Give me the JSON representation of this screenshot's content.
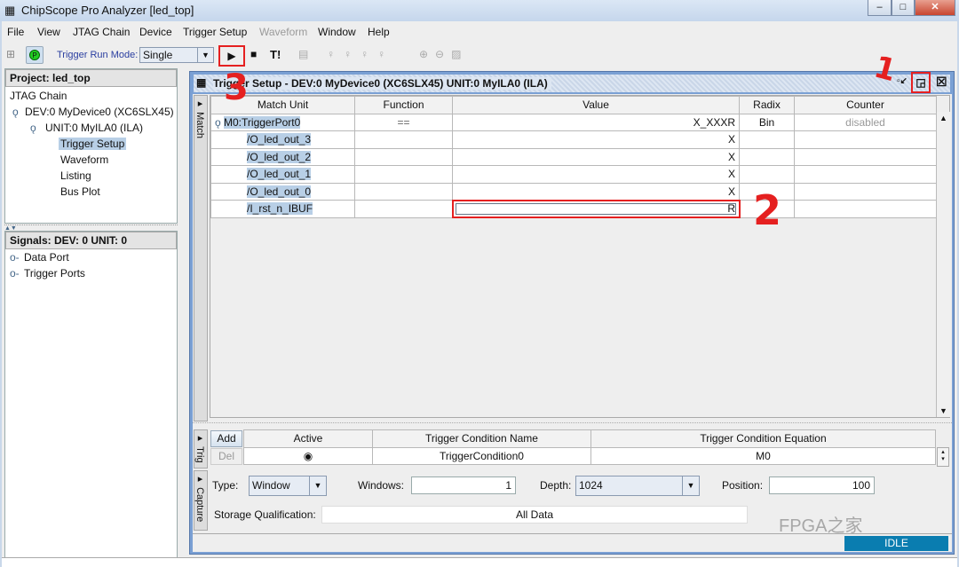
{
  "window": {
    "title": "ChipScope Pro Analyzer [led_top]",
    "controls": [
      "minimize",
      "maximize",
      "close"
    ]
  },
  "menu": [
    {
      "label": "File"
    },
    {
      "label": "View"
    },
    {
      "label": "JTAG Chain"
    },
    {
      "label": "Device"
    },
    {
      "label": "Trigger Setup"
    },
    {
      "label": "Waveform",
      "disabled": true
    },
    {
      "label": "Window"
    },
    {
      "label": "Help"
    }
  ],
  "toolbar": {
    "run_mode_label": "Trigger Run Mode:",
    "run_mode_value": "Single",
    "trigger_immediate": "T!",
    "status_led": "P"
  },
  "project": {
    "header": "Project: led_top",
    "tree": [
      "JTAG Chain",
      "DEV:0 MyDevice0 (XC6SLX45)",
      "UNIT:0 MyILA0 (ILA)",
      "Trigger Setup",
      "Waveform",
      "Listing",
      "Bus Plot"
    ],
    "selected": "Trigger Setup"
  },
  "signals": {
    "header": "Signals: DEV: 0 UNIT: 0",
    "items": [
      "Data Port",
      "Trigger Ports"
    ]
  },
  "trigger_window": {
    "title": "Trigger Setup - DEV:0 MyDevice0 (XC6SLX45) UNIT:0 MyILA0 (ILA)",
    "match_tab": "Match",
    "trig_tab": "Trig",
    "capture_tab": "Capture",
    "columns": [
      "Match Unit",
      "Function",
      "Value",
      "Radix",
      "Counter"
    ],
    "rows": [
      {
        "unit": "M0:TriggerPort0",
        "function": "==",
        "value": "X_XXXR",
        "radix": "Bin",
        "counter": "disabled"
      },
      {
        "unit": "/O_led_out_3",
        "function": "",
        "value": "X",
        "radix": "",
        "counter": ""
      },
      {
        "unit": "/O_led_out_2",
        "function": "",
        "value": "X",
        "radix": "",
        "counter": ""
      },
      {
        "unit": "/O_led_out_1",
        "function": "",
        "value": "X",
        "radix": "",
        "counter": ""
      },
      {
        "unit": "/O_led_out_0",
        "function": "",
        "value": "X",
        "radix": "",
        "counter": ""
      },
      {
        "unit": "/I_rst_n_IBUF",
        "function": "",
        "value": "R",
        "radix": "",
        "counter": ""
      }
    ],
    "trig": {
      "add": "Add",
      "del": "Del",
      "columns": [
        "Active",
        "Trigger Condition Name",
        "Trigger Condition Equation"
      ],
      "row": {
        "active": true,
        "name": "TriggerCondition0",
        "equation": "M0"
      }
    },
    "capture": {
      "type_label": "Type:",
      "type_value": "Window",
      "windows_label": "Windows:",
      "windows_value": "1",
      "depth_label": "Depth:",
      "depth_value": "1024",
      "position_label": "Position:",
      "position_value": "100",
      "storage_label": "Storage Qualification:",
      "storage_value": "All Data"
    },
    "status": "IDLE"
  },
  "annotations": [
    "1",
    "2",
    "3"
  ],
  "watermark": "FPGA之家",
  "colors": {
    "status_bar": "#0a7db0",
    "annotation": "#e52020",
    "selection": "#b8cfe6"
  }
}
